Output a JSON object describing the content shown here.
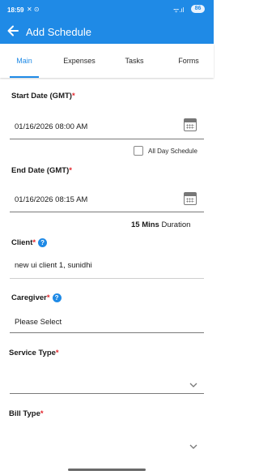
{
  "status_bar": {
    "time": "18:59",
    "notif": "✕ ⊙",
    "signal": "ᯤ.ıl",
    "battery": "86"
  },
  "app_bar": {
    "title": "Add Schedule"
  },
  "tabs": [
    {
      "label": "Main",
      "active": true
    },
    {
      "label": "Expenses",
      "active": false
    },
    {
      "label": "Tasks",
      "active": false
    },
    {
      "label": "Forms",
      "active": false
    }
  ],
  "required_mark": "*",
  "help_glyph": "?",
  "start_date": {
    "label": "Start Date (GMT)",
    "value": "01/16/2026 08:00 AM"
  },
  "all_day": {
    "label": "All Day Schedule",
    "checked": false
  },
  "end_date": {
    "label": "End Date (GMT)",
    "value": "01/16/2026 08:15 AM"
  },
  "duration": {
    "amount": "15 Mins",
    "label": "Duration"
  },
  "client": {
    "label": "Client",
    "value": "new ui client 1, sunidhi"
  },
  "caregiver": {
    "label": "Caregiver",
    "value": "Please Select"
  },
  "service_type": {
    "label": "Service Type",
    "value": ""
  },
  "bill_type": {
    "label": "Bill Type",
    "value": ""
  },
  "colors": {
    "primary": "#1f8ae6",
    "required": "#e3242b"
  }
}
